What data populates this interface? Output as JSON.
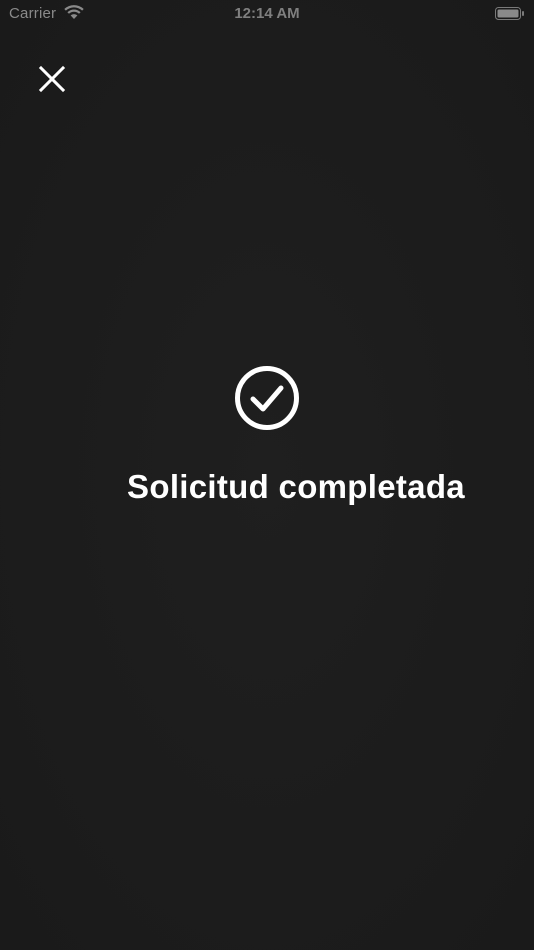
{
  "status_bar": {
    "carrier": "Carrier",
    "time": "12:14 AM",
    "wifi_icon": "wifi-icon",
    "battery_icon": "battery-icon"
  },
  "close_button": {
    "icon": "close-icon"
  },
  "success": {
    "icon": "check-circle-icon",
    "message": "Solicitud completada"
  },
  "colors": {
    "background": "#1d1e1e",
    "foreground": "#ffffff",
    "status_text": "#7f7f7f"
  }
}
